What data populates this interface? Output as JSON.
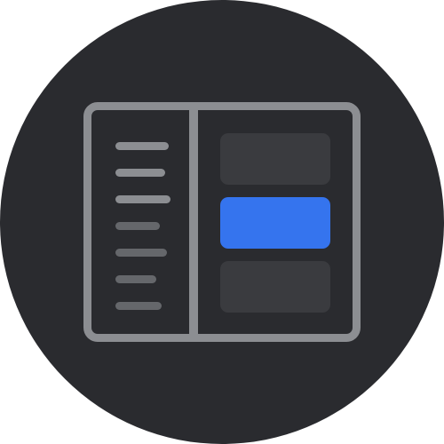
{
  "icon": {
    "name": "sidebar-layout-icon",
    "colors": {
      "background": "#2a2b2f",
      "frame": "#8c8e92",
      "sidebar_line_bright": "#8c8e92",
      "sidebar_line_dim": "#65676b",
      "card": "#3a3b3f",
      "card_selected": "#3574ee"
    },
    "sidebar_items": 7,
    "cards": 3,
    "selected_card_index": 1
  }
}
